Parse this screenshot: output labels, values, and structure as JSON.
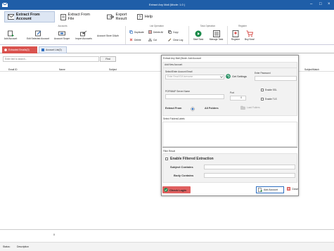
{
  "window": {
    "title": "Extract Any Mail (Mode: 1.0 )"
  },
  "main_tabs": [
    {
      "label": "Extract From Account",
      "active": true,
      "icon": "mail-icon"
    },
    {
      "label": "Extract From File",
      "active": false,
      "icon": "file-icon"
    },
    {
      "label": "Export Result",
      "active": false,
      "icon": "export-icon"
    },
    {
      "label": "Help",
      "active": false,
      "icon": "help-icon"
    }
  ],
  "ribbon": {
    "groups": {
      "accounts": "Accounts",
      "list_operation": "List Operation",
      "task_operation": "Task Operation",
      "register": "Register"
    },
    "add_account": "Add Account",
    "edit_account": "Edit Selected Account",
    "account_scope": "Account Scope",
    "import_accounts": "Import Accounts",
    "account_store_oauth": "Account Store OAuth",
    "duplicate": "Duplicate",
    "delete_all": "Delete All",
    "copy": "Copy",
    "delete": "Delete",
    "cut": "Cut",
    "clear_log": "Clear Log",
    "start_task": "Start Task",
    "manage_task": "Manage Task",
    "register": "Register",
    "buy_now": "Buy Now!"
  },
  "subtabs": [
    {
      "label": "Extracted Emails(0)",
      "active": true
    },
    {
      "label": "Account List(0)",
      "active": false
    }
  ],
  "search": {
    "placeholder": "Enter text to search...",
    "find_label": "Find"
  },
  "grid": {
    "columns": [
      "Email ID",
      "Name",
      "Subject",
      "Subject/Match"
    ]
  },
  "footer": {
    "count": "0"
  },
  "status": {
    "label": "Status:",
    "value": "Description"
  },
  "dialog": {
    "title": "Extract Any Mail (Mode: Add Account",
    "section_title": "Add New Account",
    "select_email_label": "Select/Enter Account Email",
    "email_placeholder": "Enter Email ID/Username",
    "get_settings": "Get Settings",
    "password_label": "Enter Password",
    "server_label": "POP/IMAP Server Name",
    "port_label": "Port",
    "port_value": "0",
    "enable_ssl": "Enable SSL",
    "enable_tls": "Enable TLS",
    "extract_from_label": "Extract From",
    "all_folders": "All Folders",
    "load_folders": "Load Folders",
    "select_folders_label": "Select Folders/Labels",
    "filter_result_label": "Filter Result",
    "enable_filtered": "Enable Filtered Extraction",
    "subject_contains": "Subject Contains",
    "body_contains": "Body Contains",
    "check_login": "Check Login",
    "add_account": "Add Account",
    "close": "Close"
  },
  "colors": {
    "title_bar": "#1f5ea8",
    "subtab_active": "#d9534f",
    "subtab_blue": "#2f6fc0",
    "check_login": "#e06060",
    "accent": "#2f6fc0"
  }
}
